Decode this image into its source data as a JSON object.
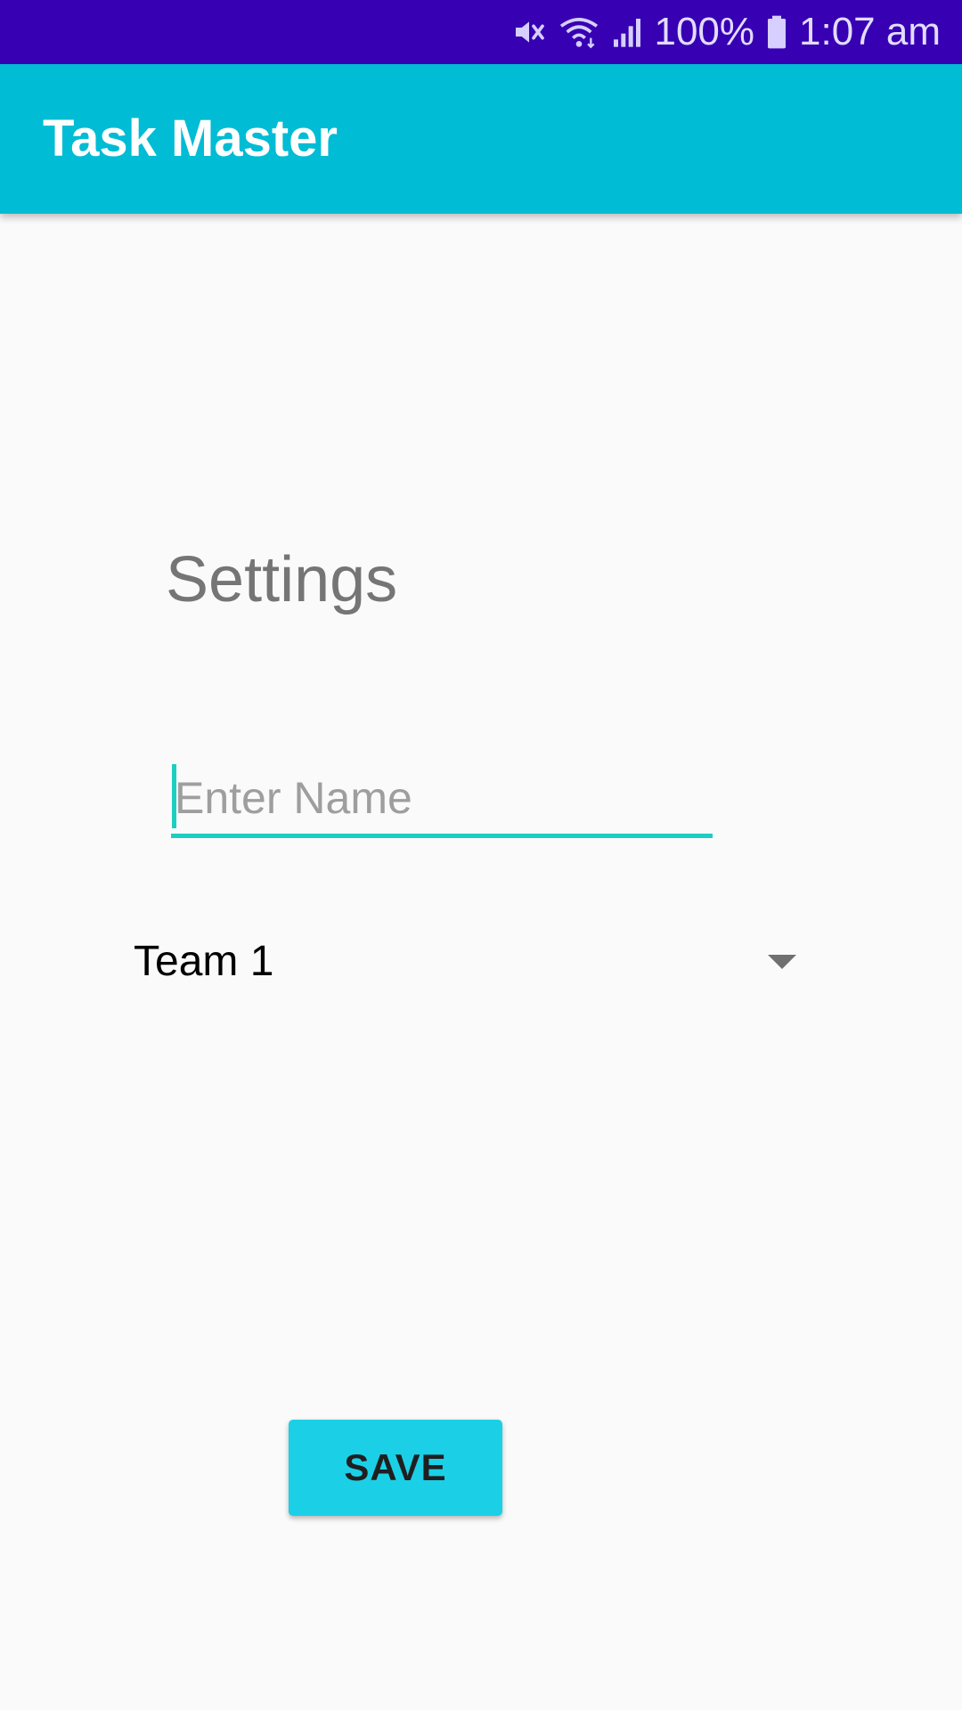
{
  "status_bar": {
    "battery": "100%",
    "time": "1:07 am",
    "icons": [
      "mute-icon",
      "wifi-icon",
      "signal-icon",
      "battery-icon"
    ]
  },
  "app_bar": {
    "title": "Task Master"
  },
  "main": {
    "heading": "Settings",
    "name_input": {
      "value": "",
      "placeholder": "Enter Name"
    },
    "team_spinner": {
      "selected": "Team 1"
    },
    "save_label": "SAVE"
  },
  "colors": {
    "status_bar": "#3700b3",
    "app_bar": "#00bcd4",
    "accent": "#1ccfc0",
    "button": "#1bd0e6",
    "background": "#fafafa"
  }
}
